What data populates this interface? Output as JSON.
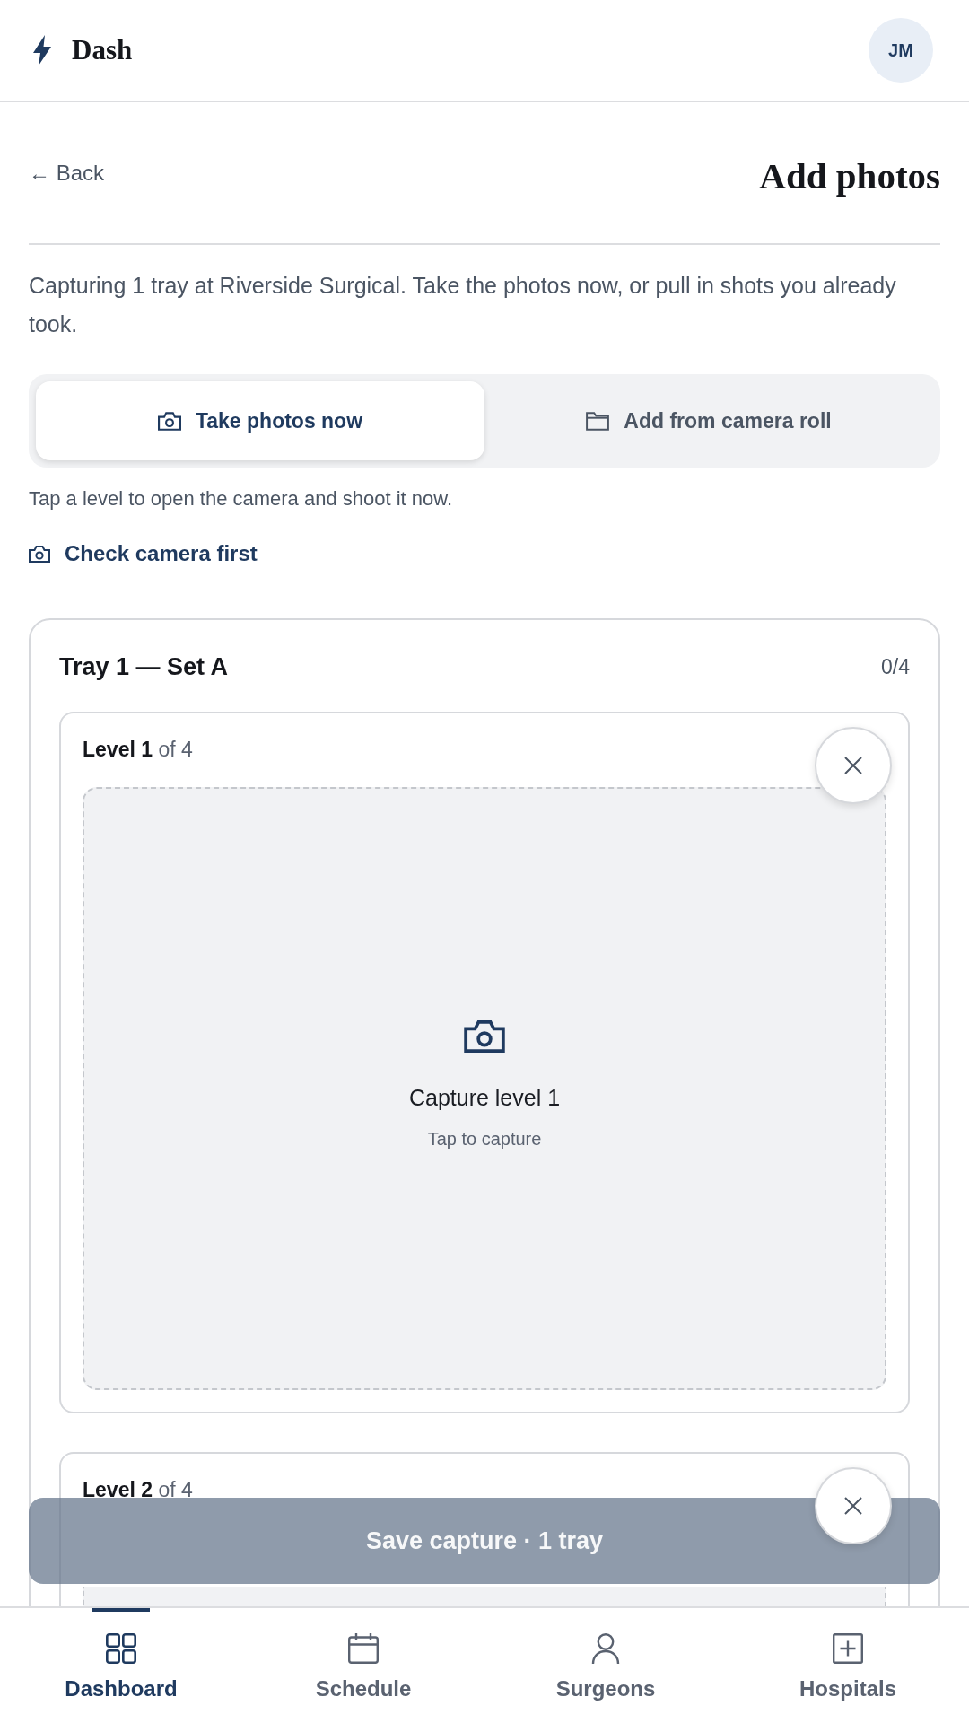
{
  "header": {
    "brand": "Dash",
    "avatar_initials": "JM"
  },
  "page": {
    "back": "← Back",
    "title": "Add photos",
    "description": "Capturing 1 tray at Riverside Surgical. Take the photos now, or pull in shots you already took."
  },
  "source_tabs": [
    {
      "label": "Take photos now",
      "selected": true
    },
    {
      "label": "Add from camera roll",
      "selected": false
    }
  ],
  "helper_text": "Tap a level to open the camera and shoot it now.",
  "check_camera_link": "Check camera first",
  "trays": [
    {
      "title": "Tray 1 — Set A",
      "count": "0/4",
      "levels": [
        {
          "label": "**Level 1** of 4",
          "capture_title": "Capture level 1",
          "capture_hint": "Tap to capture"
        },
        {
          "label": "**Level 2** of 4"
        }
      ]
    }
  ],
  "save_button": {
    "label": "Save capture · 1 tray",
    "disabled": true
  },
  "bottom_nav": [
    {
      "label": "Dashboard",
      "selected": true
    },
    {
      "label": "Schedule",
      "selected": false
    },
    {
      "label": "Surgeons",
      "selected": false
    },
    {
      "label": "Hospitals",
      "selected": false
    }
  ]
}
